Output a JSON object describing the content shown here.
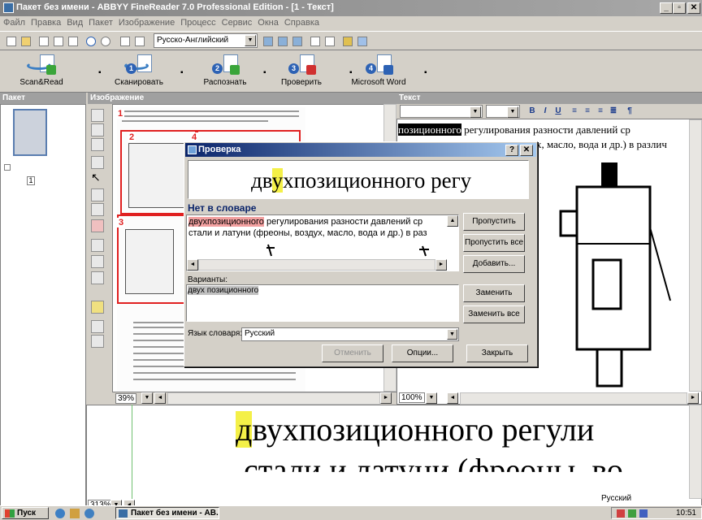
{
  "window": {
    "title": "Пакет без имени - ABBYY FineReader 7.0 Professional Edition - [1 - Текст]",
    "btn_min": "_",
    "btn_max": "▫",
    "btn_close": "✕"
  },
  "menu": [
    "Файл",
    "Правка",
    "Вид",
    "Пакет",
    "Изображение",
    "Процесс",
    "Сервис",
    "Окна",
    "Справка"
  ],
  "toolbar": {
    "language": "Русско-Английский"
  },
  "bigtools": [
    {
      "label": "Scan&Read",
      "num": ""
    },
    {
      "label": "Сканировать",
      "num": "1"
    },
    {
      "label": "Распознать",
      "num": "2"
    },
    {
      "label": "Проверить",
      "num": "3"
    },
    {
      "label": "Microsoft Word",
      "num": "4"
    }
  ],
  "panes": {
    "batch": "Пакет",
    "image": "Изображение",
    "text": "Текст"
  },
  "thumb": {
    "page_number": "1"
  },
  "image_pane": {
    "zoom": "39%",
    "labels": [
      "1",
      "2",
      "3",
      "4"
    ]
  },
  "text_pane": {
    "zoom": "100%",
    "line1_hl": "позиционного",
    "line1_rest": " регулирования разности давлений ср",
    "line2": "х, масло, вода и др.) в различ"
  },
  "bottom_pane": {
    "zoom": "313%",
    "line1_first": "д",
    "line1_rest": "вухпозиционного регули",
    "line2": "стали и латуни (фреоны, во"
  },
  "dialog": {
    "title": "Проверка",
    "btn_help": "?",
    "btn_close": "✕",
    "preview_pre": "дв",
    "preview_hl": "у",
    "preview_post": "хпозиционного регу",
    "not_in_dict": "Нет в словаре",
    "text_line1_hl": "двухпозиционного",
    "text_line1_rest": " регулирования разности давлений ср",
    "text_line2": "стали и латуни (фреоны, воздух, масло, вода и др.) в раз",
    "variants_label": "Варианты:",
    "variant": "двух позиционного",
    "dict_label": "Язык словаря:",
    "dict_value": "Русский",
    "buttons": {
      "skip": "Пропустить",
      "skip_all": "Пропустить все",
      "add": "Добавить...",
      "replace": "Заменить",
      "replace_all": "Заменить все",
      "undo": "Отменить",
      "options": "Опции...",
      "close": "Закрыть"
    }
  },
  "status": {
    "language": "Русский"
  },
  "taskbar": {
    "start": "Пуск",
    "task": "Пакет без имени - АВ...",
    "clock": "10:51"
  }
}
